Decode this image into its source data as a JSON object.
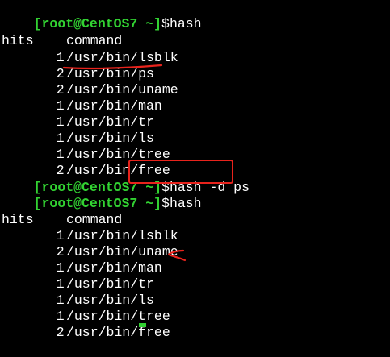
{
  "blocks": [
    {
      "prompt": "[root@CentOS7 ~]",
      "command": "$hash",
      "header": {
        "hits": "hits",
        "command": "command"
      },
      "rows": [
        {
          "hits": "1",
          "path": "/usr/bin/lsblk"
        },
        {
          "hits": "2",
          "path": "/usr/bin/ps"
        },
        {
          "hits": "2",
          "path": "/usr/bin/uname"
        },
        {
          "hits": "1",
          "path": "/usr/bin/man"
        },
        {
          "hits": "1",
          "path": "/usr/bin/tr"
        },
        {
          "hits": "1",
          "path": "/usr/bin/ls"
        },
        {
          "hits": "1",
          "path": "/usr/bin/tree"
        },
        {
          "hits": "2",
          "path": "/usr/bin/free"
        }
      ]
    },
    {
      "prompt": "[root@CentOS7 ~]",
      "command": "$hash -d ps"
    },
    {
      "prompt": "[root@CentOS7 ~]",
      "command": "$hash",
      "header": {
        "hits": "hits",
        "command": "command"
      },
      "rows": [
        {
          "hits": "1",
          "path": "/usr/bin/lsblk"
        },
        {
          "hits": "2",
          "path": "/usr/bin/uname"
        },
        {
          "hits": "1",
          "path": "/usr/bin/man"
        },
        {
          "hits": "1",
          "path": "/usr/bin/tr"
        },
        {
          "hits": "1",
          "path": "/usr/bin/ls"
        },
        {
          "hits": "1",
          "path": "/usr/bin/tree"
        },
        {
          "hits": "2",
          "path": "/usr/bin/free"
        }
      ]
    }
  ],
  "colors": {
    "background": "#000000",
    "text": "#ffffff",
    "prompt": "#32d232",
    "annotation": "#e8231c"
  }
}
